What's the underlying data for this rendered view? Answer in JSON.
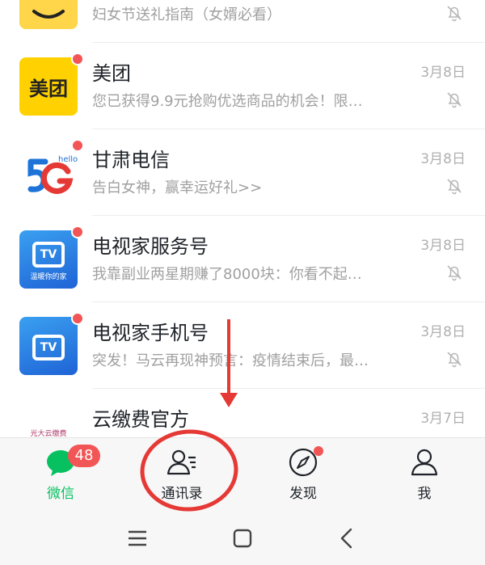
{
  "chats": [
    {
      "name": "",
      "preview": "妇女节送礼指南（女婿必看）",
      "time": "",
      "avatar": "smiley-icon",
      "muted": true,
      "dot": false
    },
    {
      "name": "美团",
      "preview": "您已获得9.9元抢购优选商品的机会！限…",
      "time": "3月8日",
      "avatar_text": "美团",
      "muted": true,
      "dot": true
    },
    {
      "name": "甘肃电信",
      "preview": "告白女神，赢幸运好礼>>",
      "time": "3月8日",
      "avatar": "5g-hello-logo",
      "muted": true,
      "dot": true
    },
    {
      "name": "电视家服务号",
      "preview": "我靠副业两星期赚了8000块：你看不起…",
      "time": "3月8日",
      "avatar_text": "TV",
      "avatar_caption": "温暖你的家",
      "muted": true,
      "dot": true
    },
    {
      "name": "电视家手机号",
      "preview": "突发！马云再现神预言：疫情结束后，最…",
      "time": "3月8日",
      "avatar_text": "TV",
      "muted": true,
      "dot": true
    },
    {
      "name": "云缴费官方",
      "preview": "",
      "time": "3月7日",
      "avatar_text": "光大云缴费",
      "muted": false,
      "dot": false
    }
  ],
  "tabs": [
    {
      "label": "微信",
      "icon": "chat-bubble-icon",
      "badge": "48",
      "active": true
    },
    {
      "label": "通讯录",
      "icon": "contacts-icon",
      "active": false
    },
    {
      "label": "发现",
      "icon": "compass-icon",
      "dot": true,
      "active": false
    },
    {
      "label": "我",
      "icon": "person-icon",
      "active": false
    }
  ],
  "system_nav": [
    "menu-icon",
    "home-icon",
    "back-icon"
  ],
  "colors": {
    "accent": "#07c160",
    "badge": "#f25555",
    "annotation": "#e53935"
  }
}
